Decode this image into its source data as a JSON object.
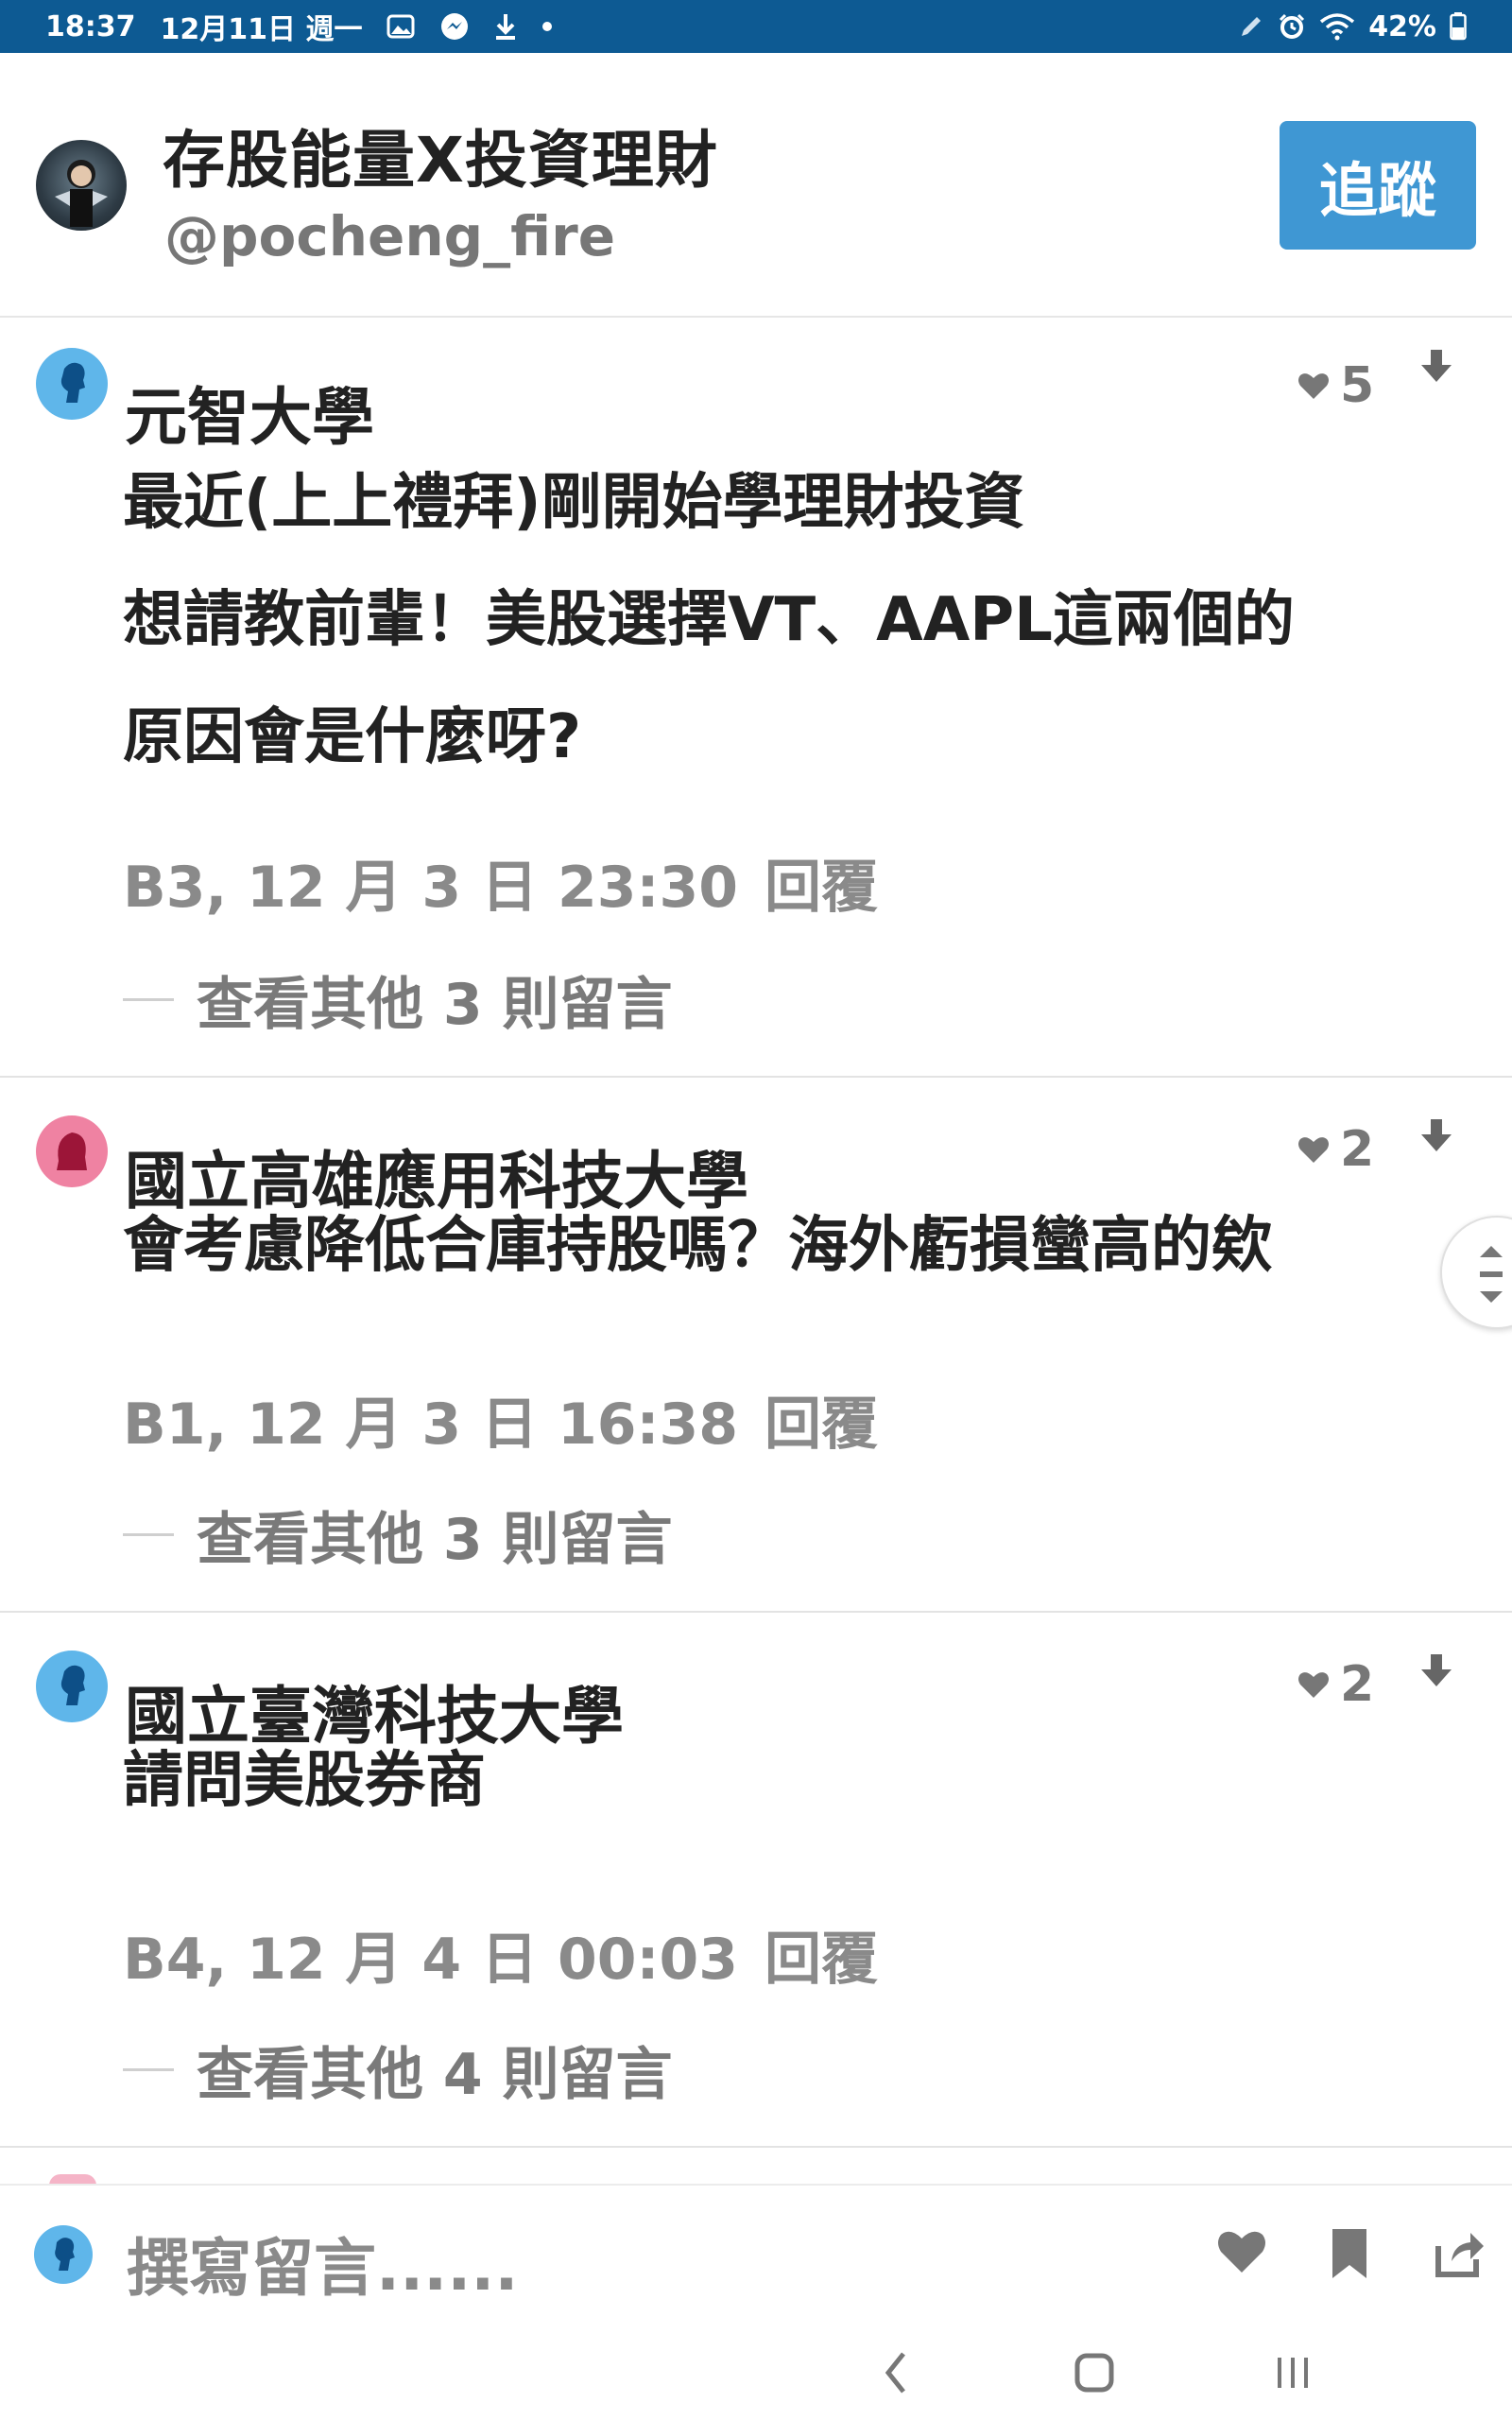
{
  "status_bar": {
    "time": "18:37",
    "date": "12月11日 週一",
    "battery": "42%",
    "icons_left": [
      "gallery-icon",
      "messenger-icon",
      "download-icon",
      "dot-icon"
    ],
    "icons_right": [
      "pen-icon",
      "alarm-icon",
      "wifi-icon",
      "battery-icon"
    ]
  },
  "header": {
    "title": "存股能量X投資理財",
    "handle": "@pocheng_fire",
    "follow_label": "追蹤"
  },
  "comments": [
    {
      "author": "元智大學",
      "avatar": "male",
      "body_lines": [
        "最近(上上禮拜)剛開始學理財投資",
        "想請教前輩！美股選擇VT、AAPL這兩個的",
        "原因會是什麼呀?"
      ],
      "meta": "B3, 12 月 3 日 23:30",
      "reply_label": "回覆",
      "more": "查看其他 3 則留言",
      "likes": "5"
    },
    {
      "author": "國立高雄應用科技大學",
      "avatar": "female",
      "body_lines": [
        "會考慮降低合庫持股嗎？海外虧損蠻高的欸"
      ],
      "meta": "B1, 12 月 3 日 16:38",
      "reply_label": "回覆",
      "more": "查看其他 3 則留言",
      "likes": "2"
    },
    {
      "author": "國立臺灣科技大學",
      "avatar": "male",
      "body_lines": [
        "請問美股券商"
      ],
      "meta": "B4, 12 月 4 日 00:03",
      "reply_label": "回覆",
      "more": "查看其他 4 則留言",
      "likes": "2"
    }
  ],
  "compose": {
    "placeholder": "撰寫留言......",
    "actions": [
      "heart-icon",
      "bookmark-icon",
      "share-icon"
    ]
  },
  "colors": {
    "status_bar": "#0d5a93",
    "follow_button": "#3f97d3",
    "male_avatar": "#5fb6ea",
    "female_avatar": "#ef82a2"
  }
}
